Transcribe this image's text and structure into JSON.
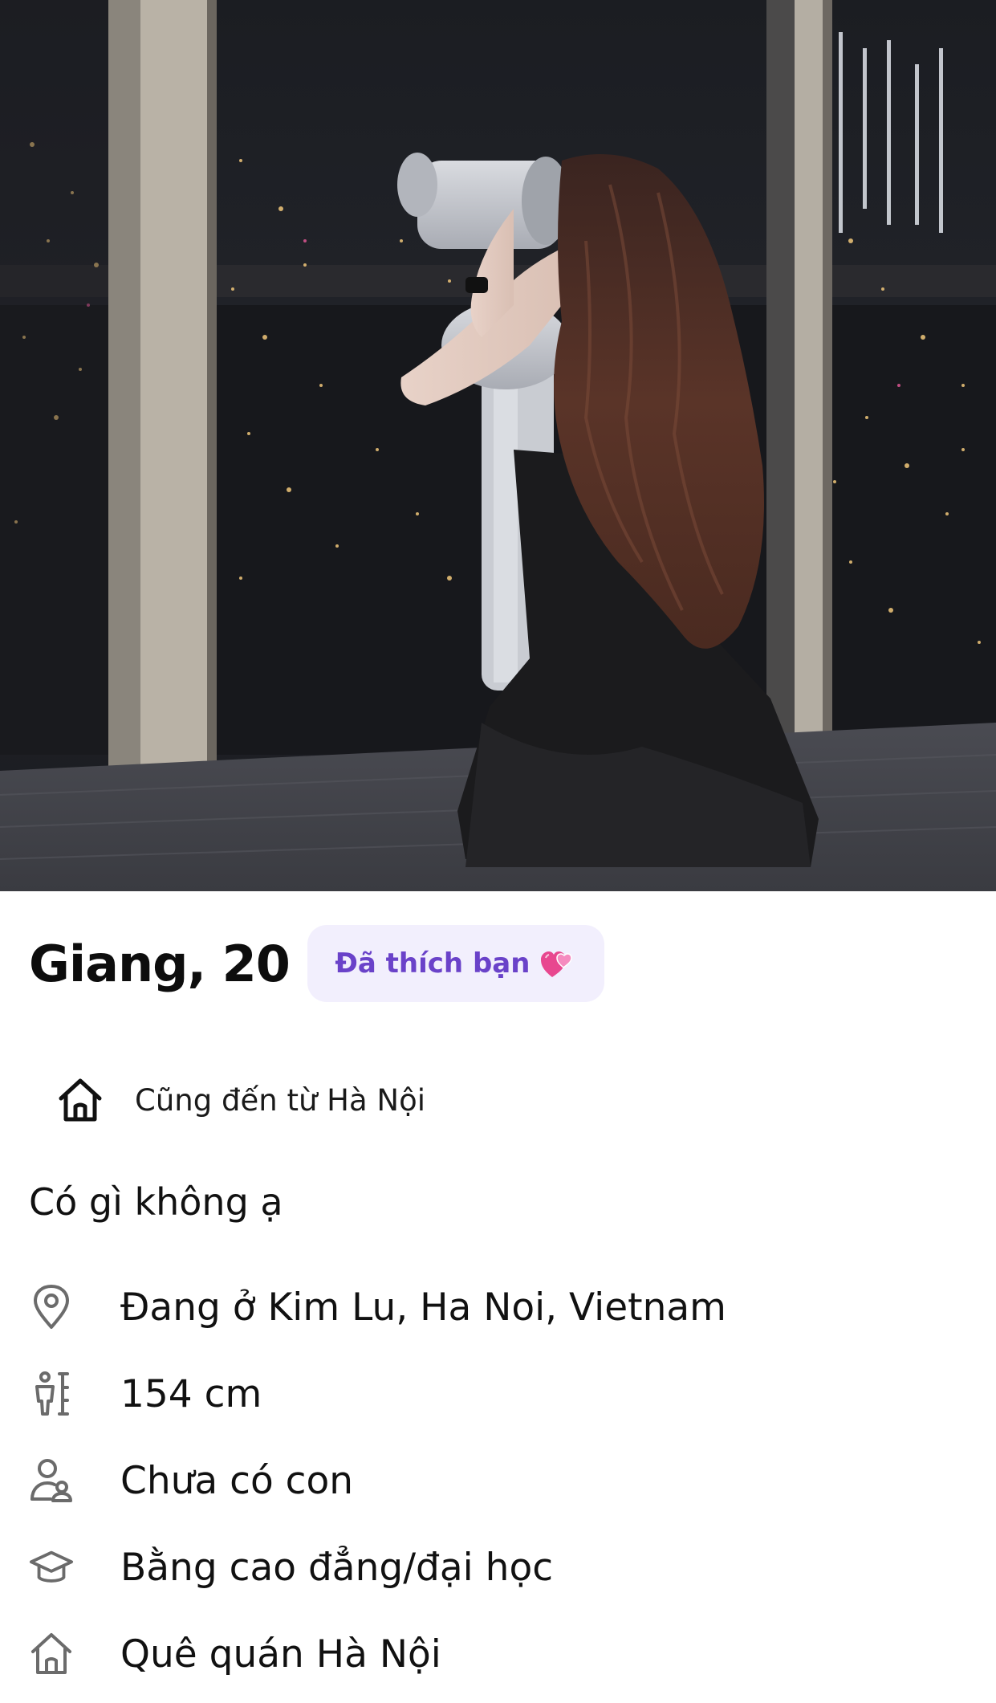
{
  "profile": {
    "name_age": "Giang, 20",
    "liked_badge": "Đã thích bạn",
    "liked_emoji": "two-hearts-icon",
    "hometown_match": "Cũng đến từ Hà Nội",
    "bio": "Có gì không ạ"
  },
  "details": [
    {
      "icon": "location-pin-icon",
      "text": "Đang ở Kim Lu, Ha Noi, Vietnam"
    },
    {
      "icon": "height-icon",
      "text": "154 cm"
    },
    {
      "icon": "children-icon",
      "text": "Chưa có con"
    },
    {
      "icon": "graduation-cap-icon",
      "text": "Bằng cao đẳng/đại học"
    },
    {
      "icon": "home-icon",
      "text": "Quê quán Hà Nội"
    }
  ],
  "colors": {
    "badge_bg": "#f2effd",
    "badge_text": "#6a42c9",
    "text": "#111111",
    "icon": "#6b6b6b"
  }
}
